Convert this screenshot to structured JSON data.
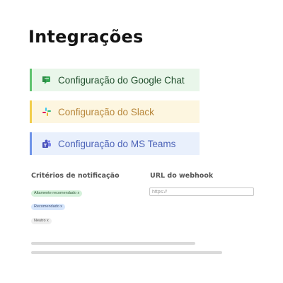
{
  "page": {
    "title": "Integrações"
  },
  "integrations": [
    {
      "label": "Configuração do Google Chat",
      "icon": "google-chat-icon",
      "accent": "#5fc36f"
    },
    {
      "label": "Configuração do Slack",
      "icon": "slack-icon",
      "accent": "#f2cd4a"
    },
    {
      "label": "Configuração do MS Teams",
      "icon": "ms-teams-icon",
      "accent": "#6e93e8"
    }
  ],
  "notification_criteria": {
    "label": "Critérios de notificação",
    "chips": [
      {
        "label": "Altamente recomendado x",
        "color": "#d6f2dc"
      },
      {
        "label": "Recomendado x",
        "color": "#d7e6fb"
      },
      {
        "label": "Neutro x",
        "color": "#efefef"
      }
    ]
  },
  "webhook": {
    "label": "URL do webhook",
    "placeholder": "https://",
    "value": ""
  }
}
